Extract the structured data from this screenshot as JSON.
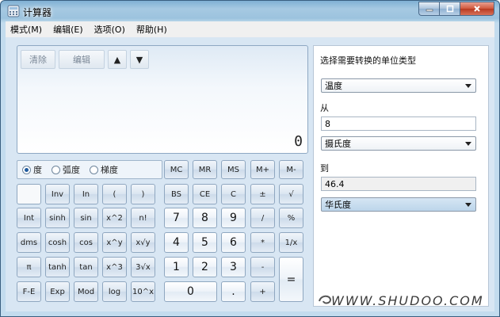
{
  "window": {
    "title": "计算器"
  },
  "menu": [
    "模式(M)",
    "编辑(E)",
    "选项(O)",
    "帮助(H)"
  ],
  "display": {
    "tools": [
      "清除",
      "编辑",
      "▲",
      "▼"
    ],
    "value": "0"
  },
  "angle_units": [
    {
      "label": "度",
      "selected": true
    },
    {
      "label": "弧度",
      "selected": false
    },
    {
      "label": "梯度",
      "selected": false
    }
  ],
  "memory_keys": [
    "MC",
    "MR",
    "MS",
    "M+",
    "M-"
  ],
  "rows": [
    [
      "",
      "Inv",
      "In",
      "(",
      ")",
      "BS",
      "CE",
      "C",
      "±",
      "√"
    ],
    [
      "Int",
      "sinh",
      "sin",
      "x^2",
      "n!",
      "7",
      "8",
      "9",
      "/",
      "%"
    ],
    [
      "dms",
      "cosh",
      "cos",
      "x^y",
      "x√y",
      "4",
      "5",
      "6",
      "*",
      "1/x"
    ],
    [
      "π",
      "tanh",
      "tan",
      "x^3",
      "3√x",
      "1",
      "2",
      "3",
      "-",
      "="
    ],
    [
      "F-E",
      "Exp",
      "Mod",
      "log",
      "10^x",
      "0",
      ".",
      "+"
    ]
  ],
  "converter": {
    "prompt": "选择需要转换的单位类型",
    "type": "温度",
    "from_label": "从",
    "from_value": "8",
    "from_unit": "摄氏度",
    "to_label": "到",
    "to_value": "46.4",
    "to_unit": "华氏度"
  },
  "watermark": "WWW.SHUDOO.COM"
}
